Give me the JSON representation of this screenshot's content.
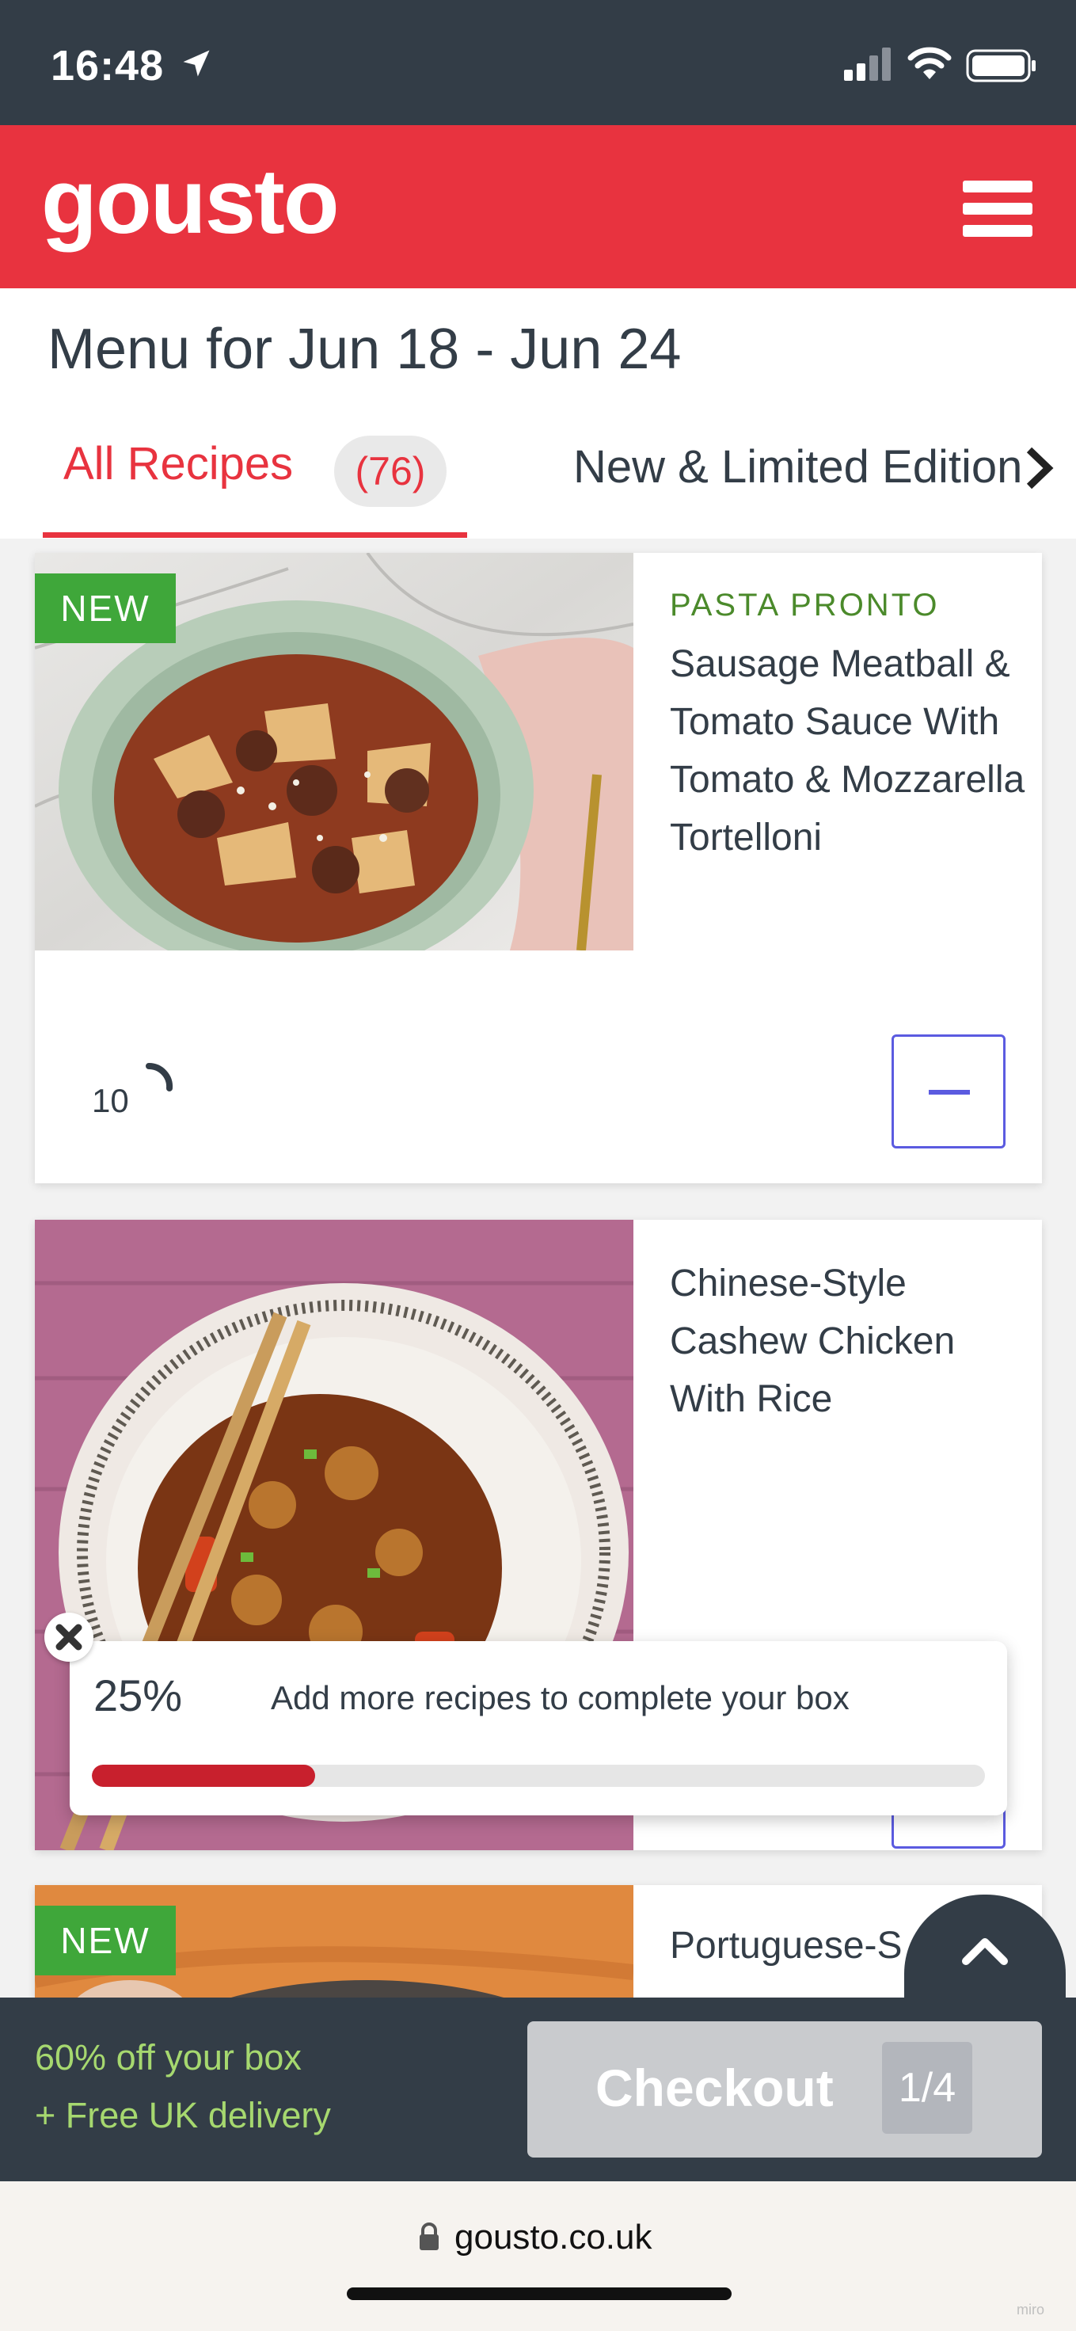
{
  "status_bar": {
    "time": "16:48",
    "icons": [
      "location-arrow-icon",
      "signal-icon",
      "wifi-icon",
      "battery-icon"
    ]
  },
  "header": {
    "logo": "gousto",
    "menu_icon": "hamburger-menu-icon",
    "brand_color": "#e8333f"
  },
  "menu": {
    "title": "Menu for Jun 18 - Jun 24",
    "tabs": [
      {
        "label": "All Recipes",
        "count": "(76)",
        "active": true
      },
      {
        "label": "New & Limited Edition",
        "active": false
      }
    ]
  },
  "recipes": [
    {
      "badge": "NEW",
      "brand": "PASTA PRONTO",
      "title": "Sausage Meatball & Tomato Sauce With Tomato & Mozzarella Tortelloni",
      "cook_time": "10",
      "in_box": true
    },
    {
      "badge": "",
      "brand": "",
      "title": "Chinese-Style Cashew Chicken With Rice",
      "in_box": true
    },
    {
      "badge": "NEW",
      "brand": "",
      "title": "Portuguese-S",
      "in_box": false
    }
  ],
  "progress": {
    "percent_label": "25%",
    "percent_value": 0.25,
    "message": "Add more recipes to complete your box"
  },
  "bottom_bar": {
    "promo_main": "60% off your box",
    "promo_sub": "+ Free UK delivery",
    "checkout_label": "Checkout",
    "checkout_count": "1/4"
  },
  "browser": {
    "url": "gousto.co.uk",
    "watermark": "miro"
  },
  "colors": {
    "dark": "#333d47",
    "accent_red": "#e8333f",
    "new_badge": "#3fa73a",
    "promo_green": "#a6d86f",
    "remove_button": "#5b5be0"
  }
}
